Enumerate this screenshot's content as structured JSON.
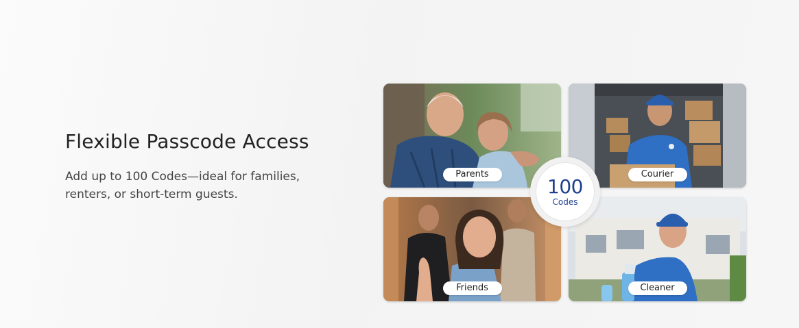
{
  "headline": "Flexible Passcode Access",
  "subtext": "Add up to 100 Codes—ideal for families, renters, or short-term guests.",
  "tiles": [
    {
      "label": "Parents"
    },
    {
      "label": "Courier"
    },
    {
      "label": "Friends"
    },
    {
      "label": "Cleaner"
    }
  ],
  "badge": {
    "number": "100",
    "unit": "Codes"
  },
  "colors": {
    "accent": "#1f3f8f",
    "uniform_blue": "#2f6fc4"
  }
}
